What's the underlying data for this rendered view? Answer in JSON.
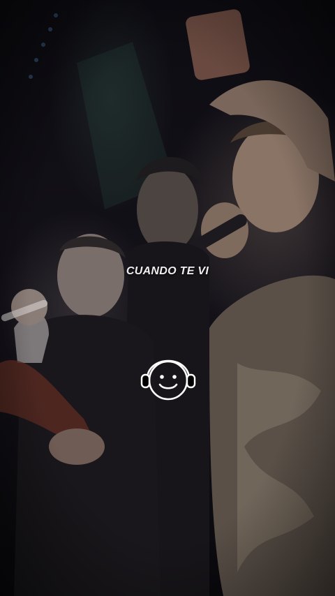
{
  "video": {
    "caption": "CUANDO TE VI",
    "logo_icon": "smiley-headphones-icon"
  },
  "colors": {
    "caption_text": "#f1eef2",
    "background": "#0b0a10"
  }
}
